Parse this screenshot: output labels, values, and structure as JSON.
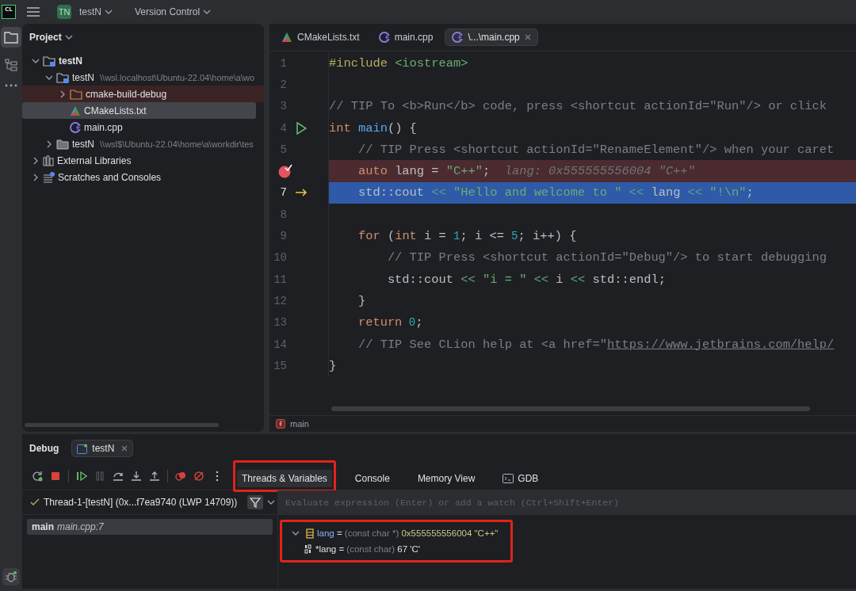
{
  "topbar": {
    "logo": "CL",
    "project": {
      "badge": "TN",
      "name": "testN"
    },
    "vcs": "Version Control"
  },
  "project_panel": {
    "title": "Project",
    "tree": [
      {
        "label": "testN",
        "kind": "module",
        "expanded": true,
        "selected": false,
        "children": [
          {
            "label": "testN",
            "path": "\\\\wsl.localhost\\Ubuntu-22.04\\home\\a\\wo",
            "kind": "module",
            "expanded": true,
            "selected": false,
            "children": [
              {
                "label": "cmake-build-debug",
                "kind": "excluded_folder",
                "expanded": false,
                "selected": false
              },
              {
                "label": "CMakeLists.txt",
                "kind": "cmake",
                "selected": true
              },
              {
                "label": "main.cpp",
                "kind": "cpp",
                "selected": false
              }
            ]
          },
          {
            "label": "testN",
            "path": "\\\\wsl$\\Ubuntu-22.04\\home\\a\\workdir\\tes",
            "kind": "folder",
            "expanded": false,
            "selected": false
          }
        ]
      },
      {
        "label": "External Libraries",
        "kind": "libraries",
        "expanded": false,
        "selected": false
      },
      {
        "label": "Scratches and Consoles",
        "kind": "scratches",
        "expanded": false,
        "selected": false
      }
    ]
  },
  "editor": {
    "tabs": [
      {
        "label": "CMakeLists.txt",
        "kind": "cmake",
        "selected": false
      },
      {
        "label": "main.cpp",
        "kind": "cpp",
        "selected": false
      },
      {
        "label": "\\...\\main.cpp",
        "kind": "cpp",
        "selected": true
      }
    ],
    "lines": [
      {
        "number": "1",
        "kind": "plain",
        "tokens": [
          {
            "kind": "pp",
            "text": "#include"
          },
          {
            "kind": "str",
            "text": " <iostream>"
          }
        ]
      },
      {
        "number": "2",
        "kind": "plain"
      },
      {
        "number": "3",
        "kind": "plain",
        "tokens": [
          {
            "kind": "com",
            "text": "// TIP To <b>Run</b> code, press <shortcut actionId=\"Run\"/> or click"
          }
        ]
      },
      {
        "number": "4",
        "kind": "runnable",
        "tokens": [
          {
            "kind": "kw",
            "text": "int"
          },
          {
            "kind": "fn",
            "text": " main"
          },
          {
            "kind": "plain",
            "text": "() {"
          }
        ]
      },
      {
        "number": "5",
        "kind": "plain",
        "tokens": [
          {
            "kind": "com",
            "text": "    // TIP Press <shortcut actionId=\"RenameElement\"/> when your caret"
          }
        ]
      },
      {
        "kind": "breakpoint",
        "tokens": [
          {
            "kind": "kw",
            "text": "    auto"
          },
          {
            "kind": "plain",
            "text": " lang = "
          },
          {
            "kind": "str",
            "text": "\"C++\""
          },
          {
            "kind": "plain",
            "text": ";"
          },
          {
            "kind": "hint",
            "text": "  lang: 0x555555556004 \"C++\""
          }
        ]
      },
      {
        "number": "7",
        "kind": "current",
        "tokens": [
          {
            "kind": "plain",
            "text": "    std::cout "
          },
          {
            "kind": "op",
            "text": "<<"
          },
          {
            "kind": "str",
            "text": " \"Hello and welcome to \""
          },
          {
            "kind": "op",
            "text": " <<"
          },
          {
            "kind": "plain",
            "text": " lang "
          },
          {
            "kind": "op",
            "text": "<<"
          },
          {
            "kind": "str",
            "text": " \"!\\n\""
          },
          {
            "kind": "plain",
            "text": ";"
          }
        ]
      },
      {
        "number": "8",
        "kind": "plain"
      },
      {
        "number": "9",
        "kind": "plain",
        "tokens": [
          {
            "kind": "kw",
            "text": "    for"
          },
          {
            "kind": "plain",
            "text": " ("
          },
          {
            "kind": "kw",
            "text": "int"
          },
          {
            "kind": "plain",
            "text": " i = "
          },
          {
            "kind": "num",
            "text": "1"
          },
          {
            "kind": "plain",
            "text": "; i <= "
          },
          {
            "kind": "num",
            "text": "5"
          },
          {
            "kind": "plain",
            "text": "; i++) {"
          }
        ]
      },
      {
        "number": "10",
        "kind": "plain",
        "tokens": [
          {
            "kind": "com",
            "text": "        // TIP Press <shortcut actionId=\"Debug\"/> to start debugging"
          }
        ]
      },
      {
        "number": "11",
        "kind": "plain",
        "tokens": [
          {
            "kind": "plain",
            "text": "        std::cout "
          },
          {
            "kind": "op",
            "text": "<<"
          },
          {
            "kind": "str",
            "text": " \"i = \""
          },
          {
            "kind": "op",
            "text": " <<"
          },
          {
            "kind": "plain",
            "text": " i "
          },
          {
            "kind": "op",
            "text": "<<"
          },
          {
            "kind": "plain",
            "text": " std::endl;"
          }
        ]
      },
      {
        "number": "12",
        "kind": "plain",
        "tokens": [
          {
            "kind": "plain",
            "text": "    }"
          }
        ]
      },
      {
        "number": "13",
        "kind": "plain",
        "tokens": [
          {
            "kind": "kw",
            "text": "    return"
          },
          {
            "kind": "num",
            "text": " 0"
          },
          {
            "kind": "plain",
            "text": ";"
          }
        ]
      },
      {
        "number": "14",
        "kind": "plain",
        "tokens": [
          {
            "kind": "com",
            "text": "    // TIP See CLion help at <a href=\""
          },
          {
            "kind": "link",
            "text": "https://www.jetbrains.com/help/"
          }
        ]
      },
      {
        "number": "15",
        "kind": "plain",
        "tokens": [
          {
            "kind": "plain",
            "text": "}"
          }
        ]
      }
    ],
    "breadcrumb": "main"
  },
  "debug": {
    "title": "Debug",
    "session": "testN",
    "tabs": [
      {
        "label": "Threads & Variables",
        "kind": "plain",
        "selected": true,
        "outlined": true
      },
      {
        "label": "Console",
        "kind": "plain",
        "selected": false,
        "outlined": false
      },
      {
        "label": "Memory View",
        "kind": "plain",
        "selected": false,
        "outlined": false
      },
      {
        "label": "GDB",
        "kind": "gdb",
        "selected": false,
        "outlined": false
      }
    ],
    "thread": "Thread-1-[testN] (0x...f7ea9740 (LWP 14709))",
    "frames": [
      {
        "function": "main",
        "location": "main.cpp:7",
        "selected": true
      }
    ],
    "evaluate": {
      "placeholder": "Evaluate expression (Enter) or add a watch (Ctrl+Shift+Enter)"
    },
    "variables": {
      "outlined": true,
      "items": [
        {
          "kind": "array",
          "name": "lang",
          "operator": "=",
          "type": "(const char *)",
          "value": "0x555555556004 \"C++\"",
          "expanded": true,
          "children": [
            {
              "kind": "primitive",
              "name": "*lang",
              "operator": "=",
              "type": "(const char)",
              "value": "67 'C'"
            }
          ]
        }
      ]
    }
  }
}
